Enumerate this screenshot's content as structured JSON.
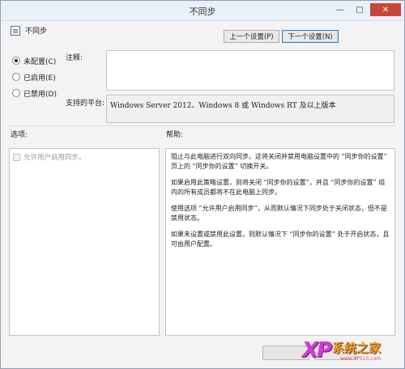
{
  "window": {
    "title": "不同步",
    "controls": {
      "minimize": "—",
      "maximize": "□",
      "close": "✕"
    }
  },
  "policy": {
    "name": "不同步",
    "icon": "policy-setting-icon"
  },
  "nav": {
    "prev": "上一个设置(P)",
    "next": "下一个设置(N)"
  },
  "state": {
    "options": [
      {
        "label": "未配置(C)",
        "selected": true
      },
      {
        "label": "已启用(E)",
        "selected": false
      },
      {
        "label": "已禁用(D)",
        "selected": false
      }
    ]
  },
  "comment": {
    "label": "注释:",
    "value": ""
  },
  "platform": {
    "label": "支持的平台:",
    "value": "Windows Server 2012、Windows 8 或 Windows RT 及以上版本"
  },
  "options_section": {
    "label": "选项:",
    "items": [
      {
        "label": "允许用户启用同步。",
        "checked": false,
        "enabled": false
      }
    ]
  },
  "help_section": {
    "label": "帮助:",
    "paragraphs": [
      "阻止与此电脑进行双向同步。这将关闭并禁用电脑设置中的 “同步你的设置” 页上的 “同步你的设置” 切换开关。",
      "如果启用此策略设置，则将关闭 “同步你的设置”，并且 “同步你的设置” 组内的所有成员都将不在此电脑上同步。",
      "使用选项 “允许用户启用同步”，从而默认情况下同步处于关闭状态，但不是禁用状态。",
      "如果未设置或禁用此设置，则默认情况下 “同步你的设置” 处于开启状态，且可由用户配置。"
    ]
  },
  "watermark": {
    "brand": "XP",
    "name": "系统之家",
    "url": "www.XP510.com"
  }
}
